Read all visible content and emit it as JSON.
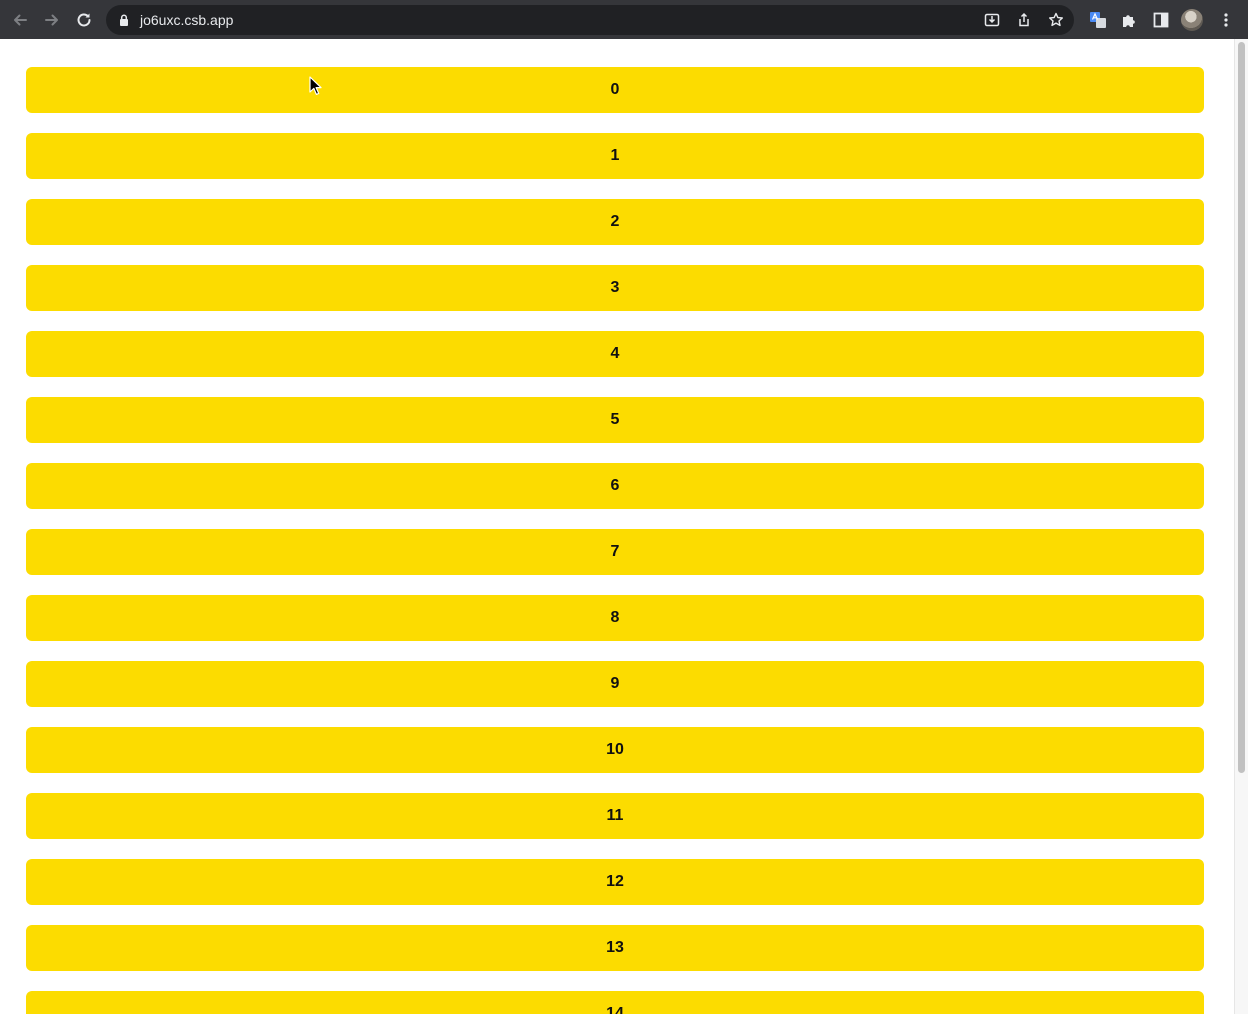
{
  "browser": {
    "url": "jo6uxc.csb.app",
    "icons": [
      "back-icon",
      "forward-icon",
      "reload-icon",
      "lock-icon",
      "install-icon",
      "share-icon",
      "bookmark-star-icon",
      "translate-icon",
      "extensions-icon",
      "side-panel-icon",
      "profile-avatar",
      "menu-icon"
    ]
  },
  "list": {
    "items": [
      "0",
      "1",
      "2",
      "3",
      "4",
      "5",
      "6",
      "7",
      "8",
      "9",
      "10",
      "11",
      "12",
      "13",
      "14"
    ]
  },
  "colors": {
    "item_background": "#fcdc00",
    "toolbar": "#35363a",
    "omnibox": "#202124"
  }
}
